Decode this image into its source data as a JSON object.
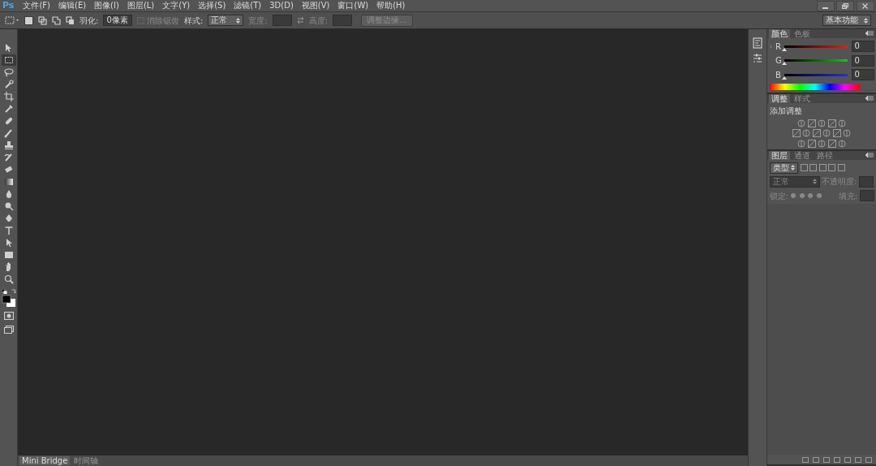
{
  "app": {
    "logo": "Ps"
  },
  "menu": [
    "文件(F)",
    "编辑(E)",
    "图像(I)",
    "图层(L)",
    "文字(Y)",
    "选择(S)",
    "滤镜(T)",
    "3D(D)",
    "视图(V)",
    "窗口(W)",
    "帮助(H)"
  ],
  "options_bar": {
    "feather_label": "羽化:",
    "feather_value": "0像素",
    "antialias": {
      "label": "消除锯齿",
      "checked": false,
      "disabled": true
    },
    "style_label": "样式:",
    "style_value": "正常",
    "width_label": "宽度:",
    "height_label": "高度:",
    "refine_button": "调整边缘...",
    "workspace": "基本功能"
  },
  "tools": [
    {
      "selected": false
    },
    {
      "selected": true
    },
    {
      "selected": false
    },
    {
      "selected": false
    },
    {
      "selected": false
    },
    {
      "selected": false
    },
    {
      "selected": false
    },
    {
      "selected": false
    },
    {
      "selected": false
    },
    {
      "selected": false
    },
    {
      "selected": false
    },
    {
      "selected": false
    },
    {
      "selected": false
    },
    {
      "selected": false
    },
    {
      "selected": false
    },
    {
      "selected": false
    },
    {
      "selected": false
    },
    {
      "selected": false
    },
    {
      "selected": false
    },
    {
      "selected": false
    }
  ],
  "color_panel": {
    "tabs": [
      {
        "label": "颜色",
        "selected": true
      },
      {
        "label": "色板",
        "selected": false
      }
    ],
    "channels": [
      {
        "name": "R",
        "value": "0",
        "level": 0
      },
      {
        "name": "G",
        "value": "0",
        "level": 0
      },
      {
        "name": "B",
        "value": "0",
        "level": 0
      }
    ]
  },
  "adjustments_panel": {
    "tabs": [
      {
        "label": "调整",
        "selected": true
      },
      {
        "label": "样式",
        "selected": false
      }
    ],
    "title": "添加调整"
  },
  "layers_panel": {
    "tabs": [
      {
        "label": "图层",
        "selected": true
      },
      {
        "label": "通道",
        "selected": false
      },
      {
        "label": "路径",
        "selected": false
      }
    ],
    "filter": "类型",
    "blend_mode": "正常",
    "opacity_label": "不透明度:",
    "lock_label": "锁定:",
    "fill_label": "填充:"
  },
  "bottom_tabs": [
    {
      "label": "Mini Bridge",
      "selected": true
    },
    {
      "label": "时间轴",
      "selected": false
    }
  ]
}
